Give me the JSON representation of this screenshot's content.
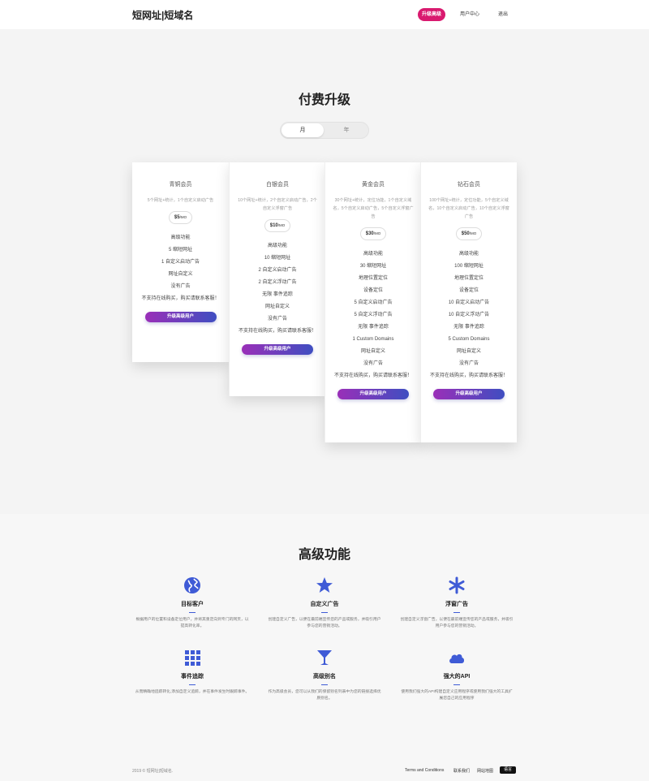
{
  "header": {
    "logo": "短网址|短域名",
    "nav": {
      "upgrade": "升级高级",
      "user_center": "用户中心",
      "logout": "退出"
    }
  },
  "pricing": {
    "title": "付费升级",
    "toggle": {
      "month": "月",
      "year": "年"
    },
    "plans": [
      {
        "name": "青铜会员",
        "desc": "5个网址+统计，1个自定义启动广告",
        "price": "$5",
        "unit": "/MO",
        "features": [
          "高级功能",
          "5 缩短网址",
          "1 自定义启动广告",
          "网址自定义",
          "没有广告",
          "不支持在线购买，购买请联系客服！"
        ],
        "button": "升级高级用户"
      },
      {
        "name": "白银会员",
        "desc": "10个网址+统计，2个自定义启动广告，2个自定义浮窗广告",
        "price": "$10",
        "unit": "/MO",
        "features": [
          "高级功能",
          "10 缩短网址",
          "2 自定义启动广告",
          "2 自定义浮动广告",
          "无限 事件追踪",
          "网址自定义",
          "没有广告",
          "不支持在线购买，购买请联系客服！"
        ],
        "button": "升级高级用户"
      },
      {
        "name": "黄金会员",
        "desc": "30个网址+统计，定位功能，1个自定义域名，5个自定义启动广告，5个自定义浮窗广告",
        "price": "$30",
        "unit": "/MO",
        "features": [
          "高级功能",
          "30 缩短网址",
          "地理位置定位",
          "设备定位",
          "5 自定义启动广告",
          "5 自定义浮动广告",
          "无限 事件追踪",
          "1 Custom Domains",
          "网址自定义",
          "没有广告",
          "不支持在线购买，购买请联系客服！"
        ],
        "button": "升级高级用户"
      },
      {
        "name": "钻石会员",
        "desc": "100个网址+统计，定位功能，5个自定义域名，10个自定义启动广告，10个自定义浮窗广告",
        "price": "$50",
        "unit": "/MO",
        "features": [
          "高级功能",
          "100 缩短网址",
          "地理位置定位",
          "设备定位",
          "10 自定义启动广告",
          "10 自定义浮动广告",
          "无限 事件追踪",
          "5 Custom Domains",
          "网址自定义",
          "没有广告",
          "不支持在线购买，购买请联系客服！"
        ],
        "button": "升级高级用户"
      }
    ]
  },
  "features_section": {
    "title": "高级功能",
    "items": [
      {
        "icon": "globe-icon",
        "title": "目标客户",
        "text": "根据用户的位置和设备定位用户，并将其重定向到专门的网页，以提高转化率。"
      },
      {
        "icon": "star-icon",
        "title": "自定义广告",
        "text": "创建自定义广告，以便在最前端宣传您的产品或服务，并吸引用户参与您的营销活动。"
      },
      {
        "icon": "asterisk-icon",
        "title": "浮窗广告",
        "text": "创建自定义浮窗广告，以便在最前端宣传您的产品或服务，并吸引用户参与您的营销活动。"
      },
      {
        "icon": "grid-icon",
        "title": "事件追踪",
        "text": "从而精确地追踪转化,添加自定义追踪，并在事件发生时跟踪事件。"
      },
      {
        "icon": "cocktail-icon",
        "title": "高级别名",
        "text": "作为高级会员，您可以从我们的保留别名列表中为您的链接选择优质别名。"
      },
      {
        "icon": "cloud-icon",
        "title": "强大的API",
        "text": "使用我们强大的API构建自定义应用程序或使用我们强大的工具扩展您自己的应用程序"
      }
    ]
  },
  "footer": {
    "copyright": "2019 © 短网址|短域名.",
    "links": [
      "Terms and Conditions",
      "联系我们",
      "网站地图"
    ],
    "language": "语言"
  },
  "colors": {
    "accent": "#d91a6f",
    "icon": "#3f5bd6",
    "gradient_start": "#9a2fb8",
    "gradient_end": "#3f4ec1"
  }
}
